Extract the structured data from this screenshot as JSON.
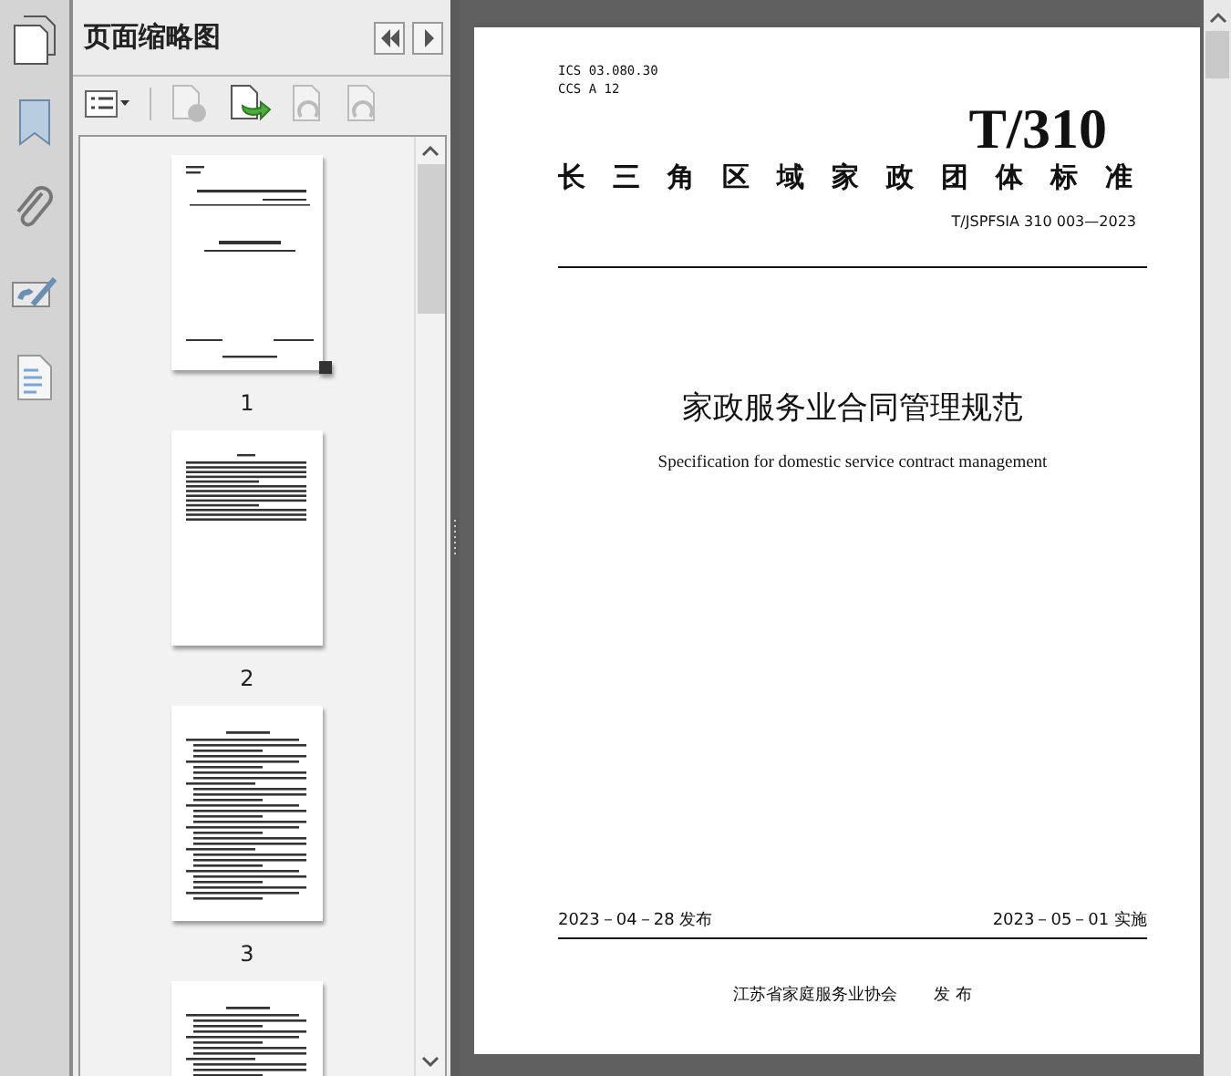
{
  "panel": {
    "title": "页面缩略图"
  },
  "thumbnails": [
    {
      "label": "1",
      "kind": "cover",
      "selected": true
    },
    {
      "label": "2",
      "kind": "preface",
      "selected": false
    },
    {
      "label": "3",
      "kind": "body",
      "selected": false
    },
    {
      "kind": "body"
    }
  ],
  "document": {
    "ics": "ICS  03.080.30",
    "ccs": "CCS A 12",
    "logo": "T/310",
    "series": "长三角区域家政团体标准",
    "code": "T/JSPFSIA 310 003—2023",
    "title": "家政服务业合同管理规范",
    "subtitle": "Specification for domestic service contract management",
    "issued": "2023－04－28 发布",
    "effective": "2023－05－01 实施",
    "publisher": "江苏省家庭服务业协会",
    "publish_word": "发 布"
  }
}
